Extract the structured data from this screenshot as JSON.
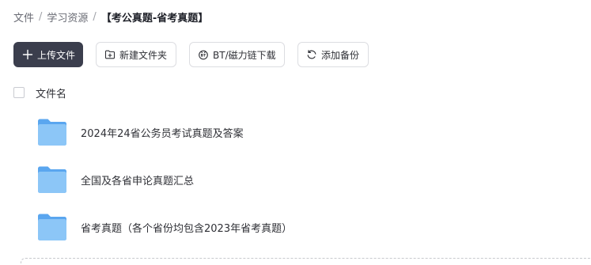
{
  "breadcrumb": {
    "items": [
      "文件",
      "学习资源"
    ],
    "separator": "/",
    "current": "【考公真题-省考真题】"
  },
  "toolbar": {
    "upload_label": "上传文件",
    "new_folder_label": "新建文件夹",
    "bt_label": "BT/磁力链下载",
    "backup_label": "添加备份"
  },
  "list": {
    "header_label": "文件名",
    "files": [
      {
        "name": "2024年24省公务员考试真题及答案",
        "icon": "folder-icon"
      },
      {
        "name": "全国及各省申论真题汇总",
        "icon": "folder-icon"
      },
      {
        "name": "省考真题（各个省份均包含2023年省考真题）",
        "icon": "folder-icon"
      }
    ]
  },
  "colors": {
    "primary_button": "#3b3e4d",
    "folder_blue": "#5aa6ef",
    "folder_light": "#8cc6f7"
  }
}
